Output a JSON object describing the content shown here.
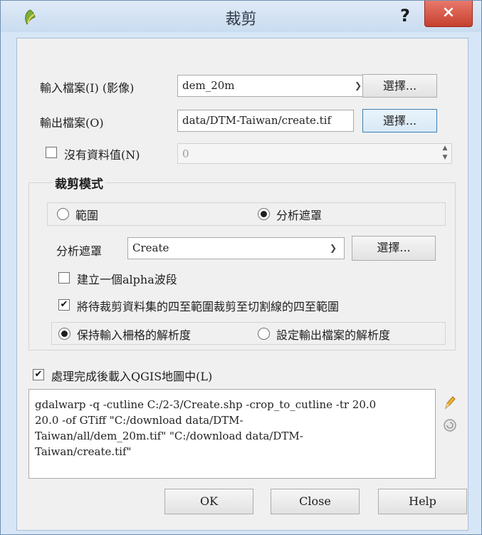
{
  "window": {
    "title": "裁剪",
    "help_glyph": "?",
    "close_glyph": "×"
  },
  "input": {
    "label": "輸入檔案(I) (影像)",
    "value": "dem_20m",
    "select_label": "選擇..."
  },
  "output": {
    "label": "輸出檔案(O)",
    "value": "data/DTM-Taiwan/create.tif",
    "select_label": "選擇..."
  },
  "nodata": {
    "label": "沒有資料值(N)",
    "checked": false,
    "value": "0"
  },
  "clip_mode": {
    "title": "裁剪模式",
    "extent_label": "範圍",
    "mask_label": "分析遮罩",
    "selected": "分析遮罩"
  },
  "mask_layer": {
    "label": "分析遮罩",
    "value": "Create",
    "select_label": "選擇..."
  },
  "alpha_band": {
    "label": "建立一個alpha波段",
    "checked": false
  },
  "crop_to_cutline": {
    "label": "將待裁剪資料集的四至範圍裁剪至切割線的四至範圍",
    "checked": true
  },
  "resolution": {
    "keep_label": "保持輸入柵格的解析度",
    "set_label": "設定輸出檔案的解析度",
    "selected": "保持輸入柵格的解析度"
  },
  "load_into_canvas": {
    "label": "處理完成後載入QGIS地圖中(L)",
    "checked": true
  },
  "command": "gdalwarp -q -cutline C:/2-3/Create.shp -crop_to_cutline -tr 20.0\n20.0 -of GTiff \"C:/download data/DTM-\nTaiwan/all/dem_20m.tif\" \"C:/download data/DTM-\nTaiwan/create.tif\"",
  "buttons": {
    "ok": "OK",
    "close": "Close",
    "help": "Help"
  },
  "check_glyph": "✔",
  "colors": {
    "titlebar": "#c9dcf0",
    "close_button": "#c7402e",
    "dialog_bg": "#f0f0f0"
  },
  "icons": {
    "app": "qgis-leaf-icon",
    "edit": "pencil-icon",
    "reset": "reset-icon"
  }
}
